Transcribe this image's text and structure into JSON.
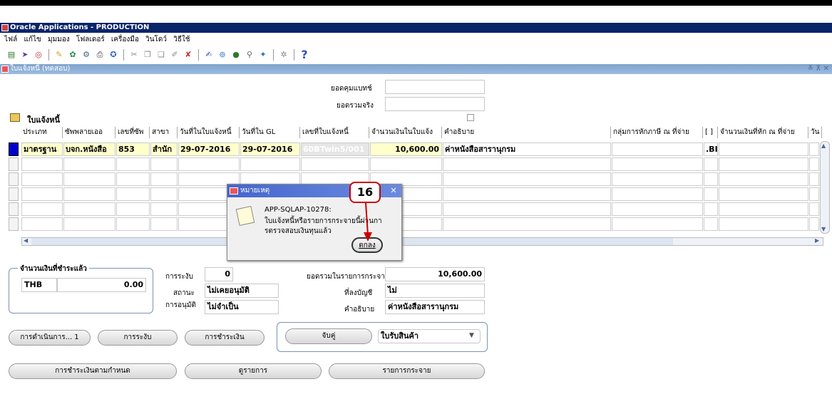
{
  "window": {
    "title": "Oracle Applications - PRODUCTION"
  },
  "menu": [
    "ไฟล์",
    "แก้ไข",
    "มุมมอง",
    "โฟลเดอร์",
    "เครื่องมือ",
    "วินโดว์",
    "วิธีใช้"
  ],
  "toolbar": {
    "help_icon": "?"
  },
  "form": {
    "title": "ใบแจ้งหนี้ (ทดสอบ)",
    "window_controls": "≚ ⊼ ✕"
  },
  "header_fields": {
    "control_total_label": "ยอดคุมแบทช์",
    "actual_total_label": "ยอดรวมจริง"
  },
  "invoices_section": {
    "title": "ใบแจ้งหนี้"
  },
  "table": {
    "headers": [
      "ประเภท",
      "ซัพพลายเออ",
      "เลขที่ซัพ",
      "สาขา",
      "วันที่ในใบแจ้งหนี้",
      "วันที่ใน GL",
      "เลขที่ใบแจ้งหนี้",
      "จำนวนเงินในใบแจ้ง",
      "คำอธิบาย",
      "กลุ่มการหักภาษี ณ ที่จ่าย",
      "[ ]",
      "จำนวนเงินที่หัก ณ ที่จ่าย",
      "วัน"
    ],
    "row1": {
      "type": "มาตรฐาน",
      "supplier": "บจก.หนังสือ",
      "supplier_no": "853",
      "branch": "สำนัก",
      "invoice_date": "29-07-2016",
      "gl_date": "29-07-2016",
      "invoice_no": "60BTwin5/001",
      "amount": "10,600.00",
      "description": "ค่าหนังสือสารานุกรม",
      "extra": ".BI"
    }
  },
  "paid": {
    "title": "จำนวนเงินที่ชำระแล้ว",
    "currency": "THB",
    "amount": "0.00"
  },
  "status": {
    "hold_label": "การระงับ",
    "hold_value": "0",
    "status_label": "สถานะ",
    "status_value": "ไม่เคยอนุมัติ",
    "approval_label": "การอนุมัติ",
    "approval_value": "ไม่จำเป็น",
    "dist_total_label": "ยอดรวมในรายการกระจาย",
    "dist_total_value": "10,600.00",
    "accounted_label": "ที่ลงบัญชี",
    "accounted_value": "ไม่",
    "desc_label": "คำอธิบาย",
    "desc_value": "ค่าหนังสือสารานุกรม"
  },
  "buttons": {
    "actions": "การดำเนินการ... 1",
    "holds": "การระงับ",
    "payments": "การชำระเงิน",
    "match": "จับคู่",
    "match_select": "ใบรับสินค้า",
    "scheduled_payments": "การชำระเงินตามกำหนด",
    "view_lines": "ดูรายการ",
    "distributions": "รายการกระจาย"
  },
  "dialog": {
    "title": "หมายเหตุ",
    "code": "APP-SQLAP-10278:",
    "message_line1": "ใบแจ้งหนี้หรือรายการกระจายนี้ผ่านกา",
    "message_line2": "รตรวจสอบเงินทุนแล้ว",
    "ok_label": "ตกลง",
    "close": "✕"
  },
  "callout": {
    "number": "16"
  },
  "colors": {
    "title_bar": "#0a246a",
    "form_bar": "#7fa3cc",
    "field_yellow": "#ffffcc",
    "annotation": "#cc0000"
  }
}
